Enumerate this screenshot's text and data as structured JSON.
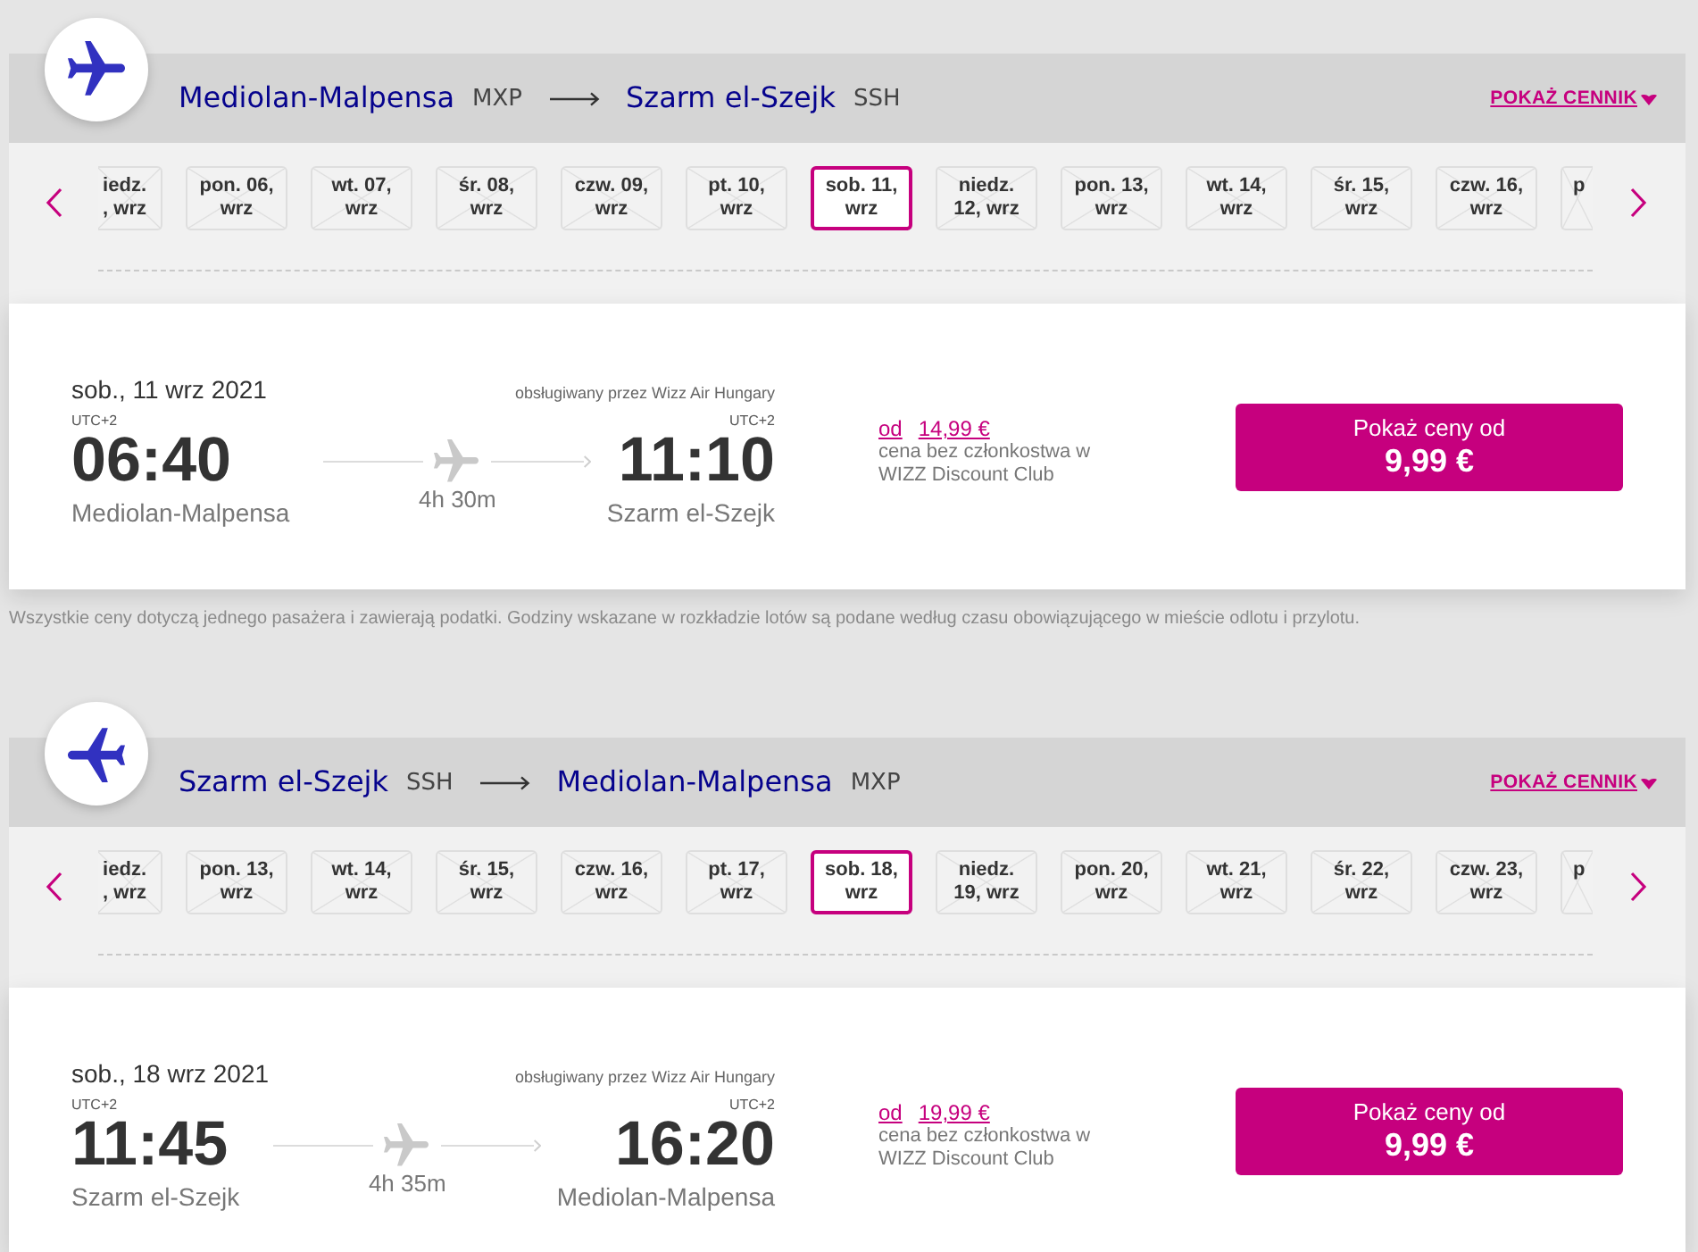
{
  "sections": [
    {
      "kind": "outbound",
      "route": {
        "origin_city": "Mediolan-Malpensa",
        "origin_code": "MXP",
        "destination_city": "Szarm el-Szejk",
        "destination_code": "SSH"
      },
      "price_list_link": "POKAŻ CENNIK",
      "dates": [
        {
          "kind": "leading",
          "lines": [
            "iedz.",
            ", wrz"
          ],
          "selected": false,
          "unavailable": true
        },
        {
          "kind": "full",
          "lines": [
            "pon. 06,",
            "wrz"
          ],
          "selected": false,
          "unavailable": true
        },
        {
          "kind": "full",
          "lines": [
            "wt. 07,",
            "wrz"
          ],
          "selected": false,
          "unavailable": true
        },
        {
          "kind": "full",
          "lines": [
            "śr. 08,",
            "wrz"
          ],
          "selected": false,
          "unavailable": true
        },
        {
          "kind": "full",
          "lines": [
            "czw. 09,",
            "wrz"
          ],
          "selected": false,
          "unavailable": true
        },
        {
          "kind": "full",
          "lines": [
            "pt. 10,",
            "wrz"
          ],
          "selected": false,
          "unavailable": true
        },
        {
          "kind": "full",
          "lines": [
            "sob. 11,",
            "wrz"
          ],
          "selected": true,
          "unavailable": false
        },
        {
          "kind": "full",
          "lines": [
            "niedz.",
            "12, wrz"
          ],
          "selected": false,
          "unavailable": true
        },
        {
          "kind": "full",
          "lines": [
            "pon. 13,",
            "wrz"
          ],
          "selected": false,
          "unavailable": true
        },
        {
          "kind": "full",
          "lines": [
            "wt. 14,",
            "wrz"
          ],
          "selected": false,
          "unavailable": true
        },
        {
          "kind": "full",
          "lines": [
            "śr. 15,",
            "wrz"
          ],
          "selected": false,
          "unavailable": true
        },
        {
          "kind": "full",
          "lines": [
            "czw. 16,",
            "wrz"
          ],
          "selected": false,
          "unavailable": true
        },
        {
          "kind": "trailing",
          "lines": [
            "p"
          ],
          "selected": false,
          "unavailable": true
        }
      ],
      "flight": {
        "date": "sob., 11 wrz 2021",
        "operator": "obsługiwany przez Wizz Air Hungary",
        "departure": {
          "timezone": "UTC+2",
          "time": "06:40",
          "airport": "Mediolan-Malpensa"
        },
        "duration": "4h 30m",
        "arrival": {
          "timezone": "UTC+2",
          "time": "11:10",
          "airport": "Szarm el-Szejk"
        },
        "fare": {
          "prefix": "od",
          "price": "14,99 €",
          "note": "cena bez członkostwa w WIZZ Discount Club"
        },
        "button": {
          "label": "Pokaż ceny od",
          "price": "9,99 €"
        }
      },
      "footnote": "Wszystkie ceny dotyczą jednego pasażera i zawierają podatki. Godziny wskazane w rozkładzie lotów są podane według czasu obowiązującego w mieście odlotu i przylotu."
    },
    {
      "kind": "return",
      "route": {
        "origin_city": "Szarm el-Szejk",
        "origin_code": "SSH",
        "destination_city": "Mediolan-Malpensa",
        "destination_code": "MXP"
      },
      "price_list_link": "POKAŻ CENNIK",
      "dates": [
        {
          "kind": "leading",
          "lines": [
            "iedz.",
            ", wrz"
          ],
          "selected": false,
          "unavailable": true
        },
        {
          "kind": "full",
          "lines": [
            "pon. 13,",
            "wrz"
          ],
          "selected": false,
          "unavailable": true
        },
        {
          "kind": "full",
          "lines": [
            "wt. 14,",
            "wrz"
          ],
          "selected": false,
          "unavailable": true
        },
        {
          "kind": "full",
          "lines": [
            "śr. 15,",
            "wrz"
          ],
          "selected": false,
          "unavailable": true
        },
        {
          "kind": "full",
          "lines": [
            "czw. 16,",
            "wrz"
          ],
          "selected": false,
          "unavailable": true
        },
        {
          "kind": "full",
          "lines": [
            "pt. 17,",
            "wrz"
          ],
          "selected": false,
          "unavailable": true
        },
        {
          "kind": "full",
          "lines": [
            "sob. 18,",
            "wrz"
          ],
          "selected": true,
          "unavailable": false
        },
        {
          "kind": "full",
          "lines": [
            "niedz.",
            "19, wrz"
          ],
          "selected": false,
          "unavailable": true
        },
        {
          "kind": "full",
          "lines": [
            "pon. 20,",
            "wrz"
          ],
          "selected": false,
          "unavailable": true
        },
        {
          "kind": "full",
          "lines": [
            "wt. 21,",
            "wrz"
          ],
          "selected": false,
          "unavailable": true
        },
        {
          "kind": "full",
          "lines": [
            "śr. 22,",
            "wrz"
          ],
          "selected": false,
          "unavailable": true
        },
        {
          "kind": "full",
          "lines": [
            "czw. 23,",
            "wrz"
          ],
          "selected": false,
          "unavailable": true
        },
        {
          "kind": "trailing",
          "lines": [
            "p"
          ],
          "selected": false,
          "unavailable": true
        }
      ],
      "flight": {
        "date": "sob., 18 wrz 2021",
        "operator": "obsługiwany przez Wizz Air Hungary",
        "departure": {
          "timezone": "UTC+2",
          "time": "11:45",
          "airport": "Szarm el-Szejk"
        },
        "duration": "4h 35m",
        "arrival": {
          "timezone": "UTC+2",
          "time": "16:20",
          "airport": "Mediolan-Malpensa"
        },
        "fare": {
          "prefix": "od",
          "price": "19,99 €",
          "note": "cena bez członkostwa w WIZZ Discount Club"
        },
        "button": {
          "label": "Pokaż ceny od",
          "price": "9,99 €"
        }
      }
    }
  ]
}
